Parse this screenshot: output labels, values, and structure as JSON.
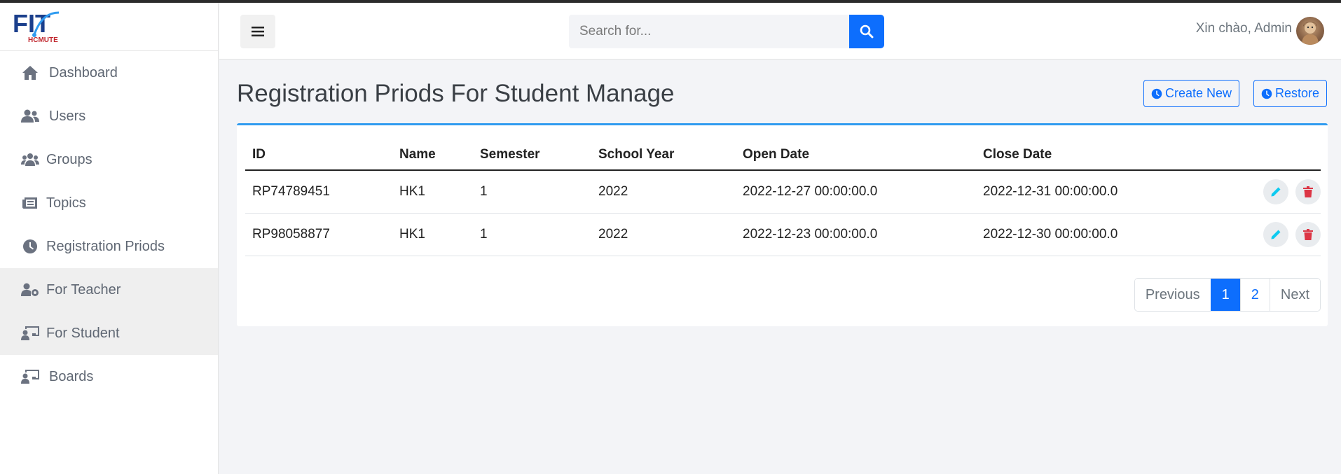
{
  "app": {
    "logo_text": "FIT",
    "logo_sub": "HCMUTE"
  },
  "sidebar": {
    "items": [
      {
        "label": "Dashboard",
        "icon": "home-icon"
      },
      {
        "label": "Users",
        "icon": "users-icon"
      },
      {
        "label": "Groups",
        "icon": "groups-icon"
      },
      {
        "label": "Topics",
        "icon": "topics-icon"
      },
      {
        "label": "Registration Priods",
        "icon": "clock-icon"
      },
      {
        "label": "For Teacher",
        "icon": "user-gear-icon"
      },
      {
        "label": "For Student",
        "icon": "chalkboard-user-icon"
      },
      {
        "label": "Boards",
        "icon": "chalkboard-user-icon"
      }
    ]
  },
  "header": {
    "search_placeholder": "Search for...",
    "greeting": "Xin chào, Admin"
  },
  "main": {
    "title": "Registration Priods For Student Manage",
    "create_label": "Create New",
    "restore_label": "Restore"
  },
  "table": {
    "columns": [
      "ID",
      "Name",
      "Semester",
      "School Year",
      "Open Date",
      "Close Date"
    ],
    "rows": [
      [
        "RP74789451",
        "HK1",
        "1",
        "2022",
        "2022-12-27 00:00:00.0",
        "2022-12-31 00:00:00.0"
      ],
      [
        "RP98058877",
        "HK1",
        "1",
        "2022",
        "2022-12-23 00:00:00.0",
        "2022-12-30 00:00:00.0"
      ]
    ]
  },
  "pagination": {
    "previous": "Previous",
    "page1": "1",
    "page2": "2",
    "next": "Next"
  },
  "colors": {
    "primary": "#0d6efd",
    "edit": "#0dcaf0",
    "delete": "#dc3545",
    "card_border": "#2f9bf0"
  }
}
